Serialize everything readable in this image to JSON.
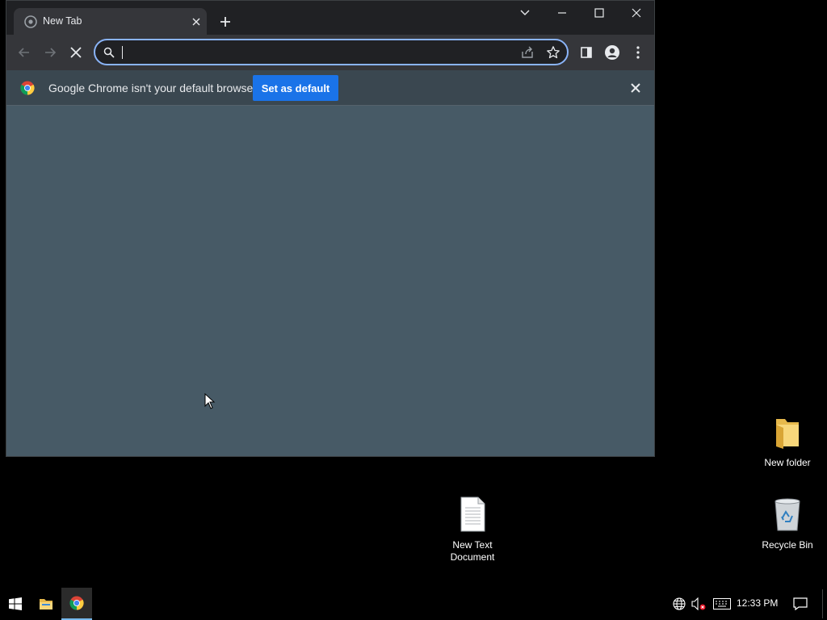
{
  "browser": {
    "tab_title": "New Tab",
    "omnibox": {
      "value": "",
      "placeholder": ""
    },
    "infobar": {
      "message": "Google Chrome isn't your default browser",
      "button_label": "Set as default"
    },
    "colors": {
      "frame": "#202124",
      "toolbar": "#35363a",
      "content": "#475a66",
      "accent": "#1a73e8",
      "focus_ring": "#8ab4f8"
    }
  },
  "desktop": {
    "icons": [
      {
        "label": "New folder",
        "icon": "folder-icon"
      },
      {
        "label": "Recycle Bin",
        "icon": "recycle-bin-icon"
      },
      {
        "label": "New Text\nDocument",
        "icon": "text-document-icon"
      }
    ]
  },
  "taskbar": {
    "clock": "12:33 PM",
    "icons": [
      "windows-start-icon",
      "file-explorer-icon",
      "chrome-icon",
      "network-icon",
      "volume-muted-icon",
      "keyboard-icon",
      "notifications-icon"
    ]
  }
}
